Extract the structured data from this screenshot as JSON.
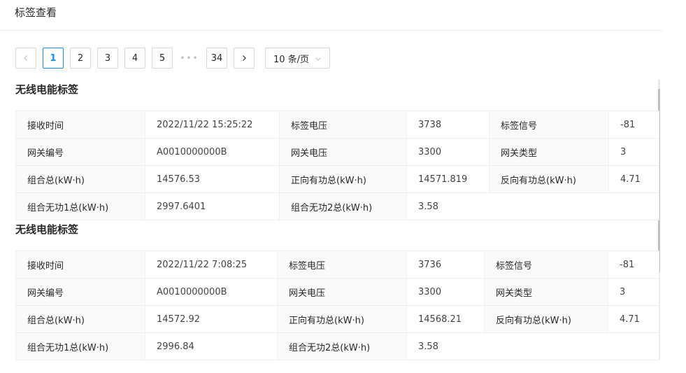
{
  "header": {
    "title": "标签查看"
  },
  "pagination": {
    "prev_icon": "chevron-left-icon",
    "next_icon": "chevron-right-icon",
    "pages": [
      "1",
      "2",
      "3",
      "4",
      "5"
    ],
    "active_page": "1",
    "ellipsis": "•••",
    "last_page": "34",
    "page_size": "10 条/页",
    "page_size_icon": "chevron-down-icon"
  },
  "records": [
    {
      "title": "无线电能标签",
      "rows": [
        [
          {
            "label": "接收时间",
            "value": "2022/11/22 15:25:22"
          },
          {
            "label": "标签电压",
            "value": "3738"
          },
          {
            "label": "标签信号",
            "value": "-81"
          }
        ],
        [
          {
            "label": "网关编号",
            "value": "A0010000000B"
          },
          {
            "label": "网关电压",
            "value": "3300"
          },
          {
            "label": "网关类型",
            "value": "3"
          }
        ],
        [
          {
            "label": "组合总(kW·h)",
            "value": "14576.53"
          },
          {
            "label": "正向有功总(kW·h)",
            "value": "14571.819"
          },
          {
            "label": "反向有功总(kW·h)",
            "value": "4.71"
          }
        ],
        [
          {
            "label": "组合无功1总(kW·h)",
            "value": "2997.6401"
          },
          {
            "label": "组合无功2总(kW·h)",
            "value": "3.58"
          }
        ]
      ]
    },
    {
      "title": "无线电能标签",
      "rows": [
        [
          {
            "label": "接收时间",
            "value": "2022/11/22 7:08:25"
          },
          {
            "label": "标签电压",
            "value": "3736"
          },
          {
            "label": "标签信号",
            "value": "-81"
          }
        ],
        [
          {
            "label": "网关编号",
            "value": "A0010000000B"
          },
          {
            "label": "网关电压",
            "value": "3300"
          },
          {
            "label": "网关类型",
            "value": "3"
          }
        ],
        [
          {
            "label": "组合总(kW·h)",
            "value": "14572.92"
          },
          {
            "label": "正向有功总(kW·h)",
            "value": "14568.21"
          },
          {
            "label": "反向有功总(kW·h)",
            "value": "4.71"
          }
        ],
        [
          {
            "label": "组合无功1总(kW·h)",
            "value": "2996.84"
          },
          {
            "label": "组合无功2总(kW·h)",
            "value": "3.58"
          }
        ]
      ]
    }
  ],
  "colors": {
    "accent": "#1890ff",
    "border": "#f0f0f0",
    "label_bg": "#fafafa"
  }
}
